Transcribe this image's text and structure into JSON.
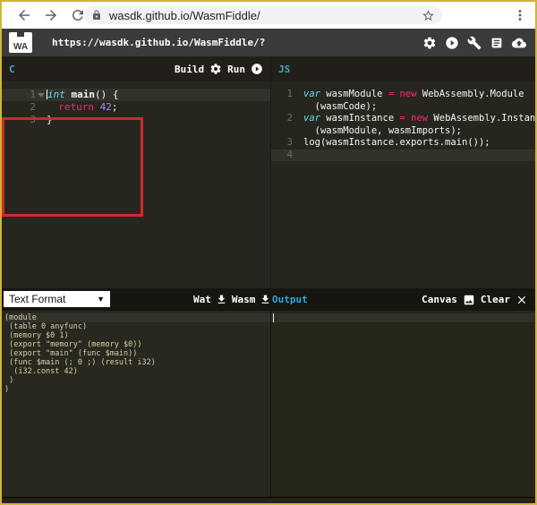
{
  "colors": {
    "gold_border": "#d4b33c",
    "accent_cyan": "#2ea7de",
    "annotation_red": "#cf2b27",
    "code_cyan": "#66d9ef",
    "code_pink": "#f92672",
    "code_purple": "#ae81ff",
    "editor_bg": "#26261f"
  },
  "browser": {
    "url": "wasdk.github.io/WasmFiddle/",
    "icons": [
      "back-icon",
      "forward-icon",
      "reload-icon",
      "lock-icon",
      "star-icon",
      "menu-icon"
    ]
  },
  "app_header": {
    "logo": "WA",
    "url": "https://wasdk.github.io/WasmFiddle/?",
    "icons": [
      "gear-icon",
      "play-circle-icon",
      "wrench-icon",
      "docs-icon",
      "share-icon"
    ]
  },
  "panes": {
    "c": {
      "tab": "C",
      "build_label": "Build",
      "run_label": "Run"
    },
    "js": {
      "tab": "JS"
    }
  },
  "editors": {
    "c": {
      "rows": [
        {
          "n": "1",
          "fold": true,
          "active": true,
          "cursor": true,
          "tokens": [
            [
              "int",
              "kw"
            ],
            [
              " ",
              ""
            ],
            [
              "main",
              "fn"
            ],
            [
              "() {",
              ""
            ]
          ]
        },
        {
          "n": "2",
          "tokens": [
            [
              "  ",
              ""
            ],
            [
              "return",
              "pink"
            ],
            [
              " ",
              ""
            ],
            [
              "42",
              "num"
            ],
            [
              ";",
              ""
            ]
          ]
        },
        {
          "n": "3",
          "tokens": [
            [
              "}",
              ""
            ]
          ]
        }
      ]
    },
    "js": {
      "rows": [
        {
          "n": "1",
          "tokens": [
            [
              "var",
              "kw"
            ],
            [
              " wasmModule ",
              ""
            ],
            [
              "=",
              "pink"
            ],
            [
              " ",
              ""
            ],
            [
              "new",
              "pink"
            ],
            [
              " WebAssembly.Module",
              ""
            ]
          ]
        },
        {
          "n": "",
          "tokens": [
            [
              "  (wasmCode);",
              ""
            ]
          ]
        },
        {
          "n": "2",
          "tokens": [
            [
              "var",
              "kw"
            ],
            [
              " wasmInstance ",
              ""
            ],
            [
              "=",
              "pink"
            ],
            [
              " ",
              ""
            ],
            [
              "new",
              "pink"
            ],
            [
              " WebAssembly.Instance",
              ""
            ]
          ]
        },
        {
          "n": "",
          "tokens": [
            [
              "  (wasmModule, wasmImports);",
              ""
            ]
          ]
        },
        {
          "n": "3",
          "tokens": [
            [
              "log(wasmInstance.exports.main());",
              ""
            ]
          ]
        },
        {
          "n": "4",
          "active": true,
          "tokens": []
        }
      ]
    }
  },
  "bottom_toolbar": {
    "format_select": "Text Format",
    "wat_label": "Wat",
    "wasm_label": "Wasm",
    "output_tab": "Output",
    "canvas_label": "Canvas",
    "clear_label": "Clear",
    "icons": [
      "download-icon",
      "download-icon",
      "image-icon",
      "close-icon"
    ]
  },
  "output": {
    "lines": [
      "(module",
      " (table 0 anyfunc)",
      " (memory $0 1)",
      " (export \"memory\" (memory $0))",
      " (export \"main\" (func $main))",
      " (func $main (; 0 ;) (result i32)",
      "  (i32.const 42)",
      " )",
      ")"
    ]
  }
}
